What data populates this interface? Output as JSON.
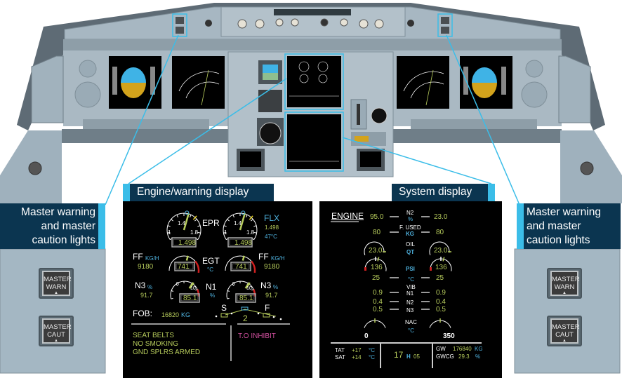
{
  "callouts": {
    "left_master": {
      "line1": "Master warning",
      "line2": "and master",
      "line3": "caution lights"
    },
    "right_master": {
      "line1": "Master warning",
      "line2": "and master",
      "line3": "caution lights"
    },
    "engine_warning": {
      "label": "Engine/warning display"
    },
    "system": {
      "label": "System display"
    }
  },
  "master_buttons": {
    "warn": {
      "line1": "MASTER",
      "line2": "WARN",
      "indicator": "▲"
    },
    "caut": {
      "line1": "MASTER",
      "line2": "CAUT",
      "indicator": "▲"
    }
  },
  "engine_display": {
    "epr_label": "EPR",
    "epr_left": "1.498",
    "epr_right": "1.498",
    "epr_ticks": [
      "1",
      "1.4",
      "1.8"
    ],
    "flx_label": "FLX",
    "flx_epr": "1.498",
    "flx_temp": "47°C",
    "ff_label": "FF",
    "ff_unit": "KG/H",
    "ff_left": "9180",
    "ff_right": "9180",
    "egt_label": "EGT",
    "egt_unit": "°C",
    "egt_left": "741",
    "egt_right": "741",
    "n3_label": "N3",
    "n3_unit": "%",
    "n3_left": "91.7",
    "n3_right": "91.7",
    "n1_label": "N1",
    "n1_unit": "%",
    "n1_left": "85.1",
    "n1_right": "85.1",
    "n1_ticks": [
      "5",
      "10"
    ],
    "fob_label": "FOB:",
    "fob_value": "16820",
    "fob_unit": "KG",
    "flaps_s": "S",
    "flaps_f": "F",
    "flaps_value": "2",
    "memo": [
      "SEAT BELTS",
      "NO SMOKING",
      "GND SPLRS ARMED"
    ],
    "inhibit": "T.O INHIBIT"
  },
  "system_display": {
    "title": "ENGINE",
    "n2_label": "N2",
    "n2_unit": "%",
    "n2_left": "95.0",
    "n2_right": "23.0",
    "fused_label": "F. USED",
    "fused_unit": "KG",
    "fused_left": "80",
    "fused_right": "80",
    "oil_label": "OIL",
    "oil_unit": "QT",
    "oil_left": "23.0",
    "oil_right": "23.0",
    "psi_unit": "PSI",
    "psi_left": "136",
    "psi_right": "136",
    "temp_unit": "°C",
    "temp_left": "25",
    "temp_right": "25",
    "vib_label": "VIB",
    "vib_rows": [
      {
        "label": "N1",
        "left": "0.9",
        "right": "0.9"
      },
      {
        "label": "N2",
        "left": "0.4",
        "right": "0.4"
      },
      {
        "label": "N3",
        "left": "0.5",
        "right": "0.5"
      }
    ],
    "nac_label": "NAC",
    "nac_unit": "°C",
    "nac_left": "0",
    "nac_right": "350",
    "tat_label": "TAT",
    "tat_value": "+17",
    "tat_unit": "°C",
    "sat_label": "SAT",
    "sat_value": "+14",
    "sat_unit": "°C",
    "time_h": "17",
    "time_h_label": "H",
    "time_m": "05",
    "gw_label": "GW",
    "gw_value": "176840",
    "gw_unit": "KG",
    "gwcg_label": "GWCG",
    "gwcg_value": "29.3",
    "gwcg_unit": "%"
  },
  "colors": {
    "callout_bg": "#0b3550",
    "callout_accent": "#3bbde8",
    "display_green": "#b7cc5c",
    "display_cyan": "#4fb3e0",
    "display_magenta": "#d1509e",
    "panel": "#aab9c3"
  }
}
